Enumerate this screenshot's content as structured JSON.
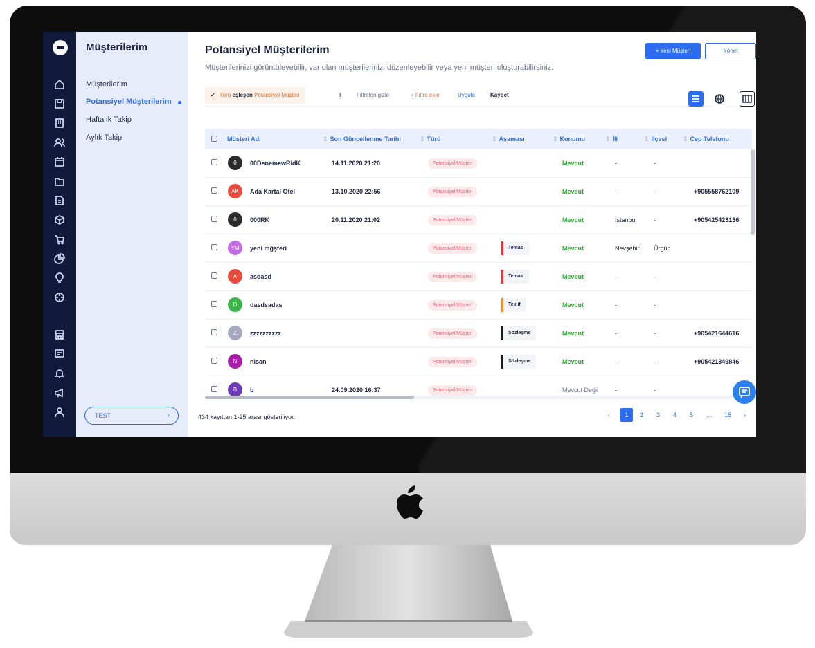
{
  "submenu": {
    "title": "Müşterilerim",
    "items": [
      {
        "label": "Müşterilerim"
      },
      {
        "label": "Potansiyel Müşterilerim"
      },
      {
        "label": "Haftalık Takip"
      },
      {
        "label": "Aylık Takip"
      }
    ],
    "account_label": "TEST",
    "account_chevron": "›"
  },
  "header": {
    "title": "Potansiyel Müşterilerim",
    "subtitle": "Müşterilerinizi görüntüleyebilir, var olan müşterilerinizi düzenleyebilir veya yeni müşteri oluşturabilirsiniz.",
    "new_button": "+ Yeni Müşteri",
    "manage_button": "Yönet"
  },
  "filters": {
    "chip_check": "✔",
    "chip_part1": "Türü",
    "chip_part2": "eşleşen",
    "chip_part3": "Potansiyel Müşteri",
    "plus": "+",
    "hide": "Filtreleri gizle",
    "add": "+ Filtre ekle",
    "apply": "Uygula",
    "save": "Kaydet"
  },
  "table": {
    "columns": [
      "Müşteri Adı",
      "Son Güncellenme Tarihi",
      "Türü",
      "Aşaması",
      "Konumu",
      "İli",
      "İlçesi",
      "Cep Telefonu"
    ],
    "rows": [
      {
        "initials": "0",
        "avatar_color": "#2b2b2b",
        "name": "00DenemewRidK",
        "date": "14.11.2020 21:20",
        "type": "Potansiyel Müşteri",
        "stage": "",
        "stage_color": "",
        "location": "Mevcut",
        "location_off": false,
        "city": "-",
        "district": "-",
        "phone": ""
      },
      {
        "initials": "AK",
        "avatar_color": "#ea4a3c",
        "name": "Ada Kartal Otel",
        "date": "13.10.2020 22:56",
        "type": "Potansiyel Müşteri",
        "stage": "",
        "stage_color": "",
        "location": "Mevcut",
        "location_off": false,
        "city": "-",
        "district": "-",
        "phone": "+905558762109"
      },
      {
        "initials": "0",
        "avatar_color": "#2b2b2b",
        "name": "000RK",
        "date": "20.11.2020 21:02",
        "type": "Potansiyel Müşteri",
        "stage": "",
        "stage_color": "",
        "location": "Mevcut",
        "location_off": false,
        "city": "İstanbul",
        "district": "-",
        "phone": "+905425423136"
      },
      {
        "initials": "YM",
        "avatar_color": "#c56ae8",
        "name": "yeni mğşteri",
        "date": "",
        "type": "Potansiyel Müşteri",
        "stage": "Temas",
        "stage_color": "#e43838",
        "location": "Mevcut",
        "location_off": false,
        "city": "Nevşehir",
        "district": "Ürgüp",
        "phone": ""
      },
      {
        "initials": "A",
        "avatar_color": "#ea4a3c",
        "name": "asdasd",
        "date": "",
        "type": "Potansiyel Müşteri",
        "stage": "Temas",
        "stage_color": "#e43838",
        "location": "Mevcut",
        "location_off": false,
        "city": "-",
        "district": "-",
        "phone": ""
      },
      {
        "initials": "D",
        "avatar_color": "#3cb54a",
        "name": "dasdsadas",
        "date": "",
        "type": "Potansiyel Müşteri",
        "stage": "Teklif",
        "stage_color": "#f08a2a",
        "location": "Mevcut",
        "location_off": false,
        "city": "-",
        "district": "-",
        "phone": ""
      },
      {
        "initials": "Z",
        "avatar_color": "#a6a8c2",
        "name": "zzzzzzzzzz",
        "date": "",
        "type": "Potansiyel Müşteri",
        "stage": "Sözleşme",
        "stage_color": "#1c1c1c",
        "location": "Mevcut",
        "location_off": false,
        "city": "-",
        "district": "-",
        "phone": "+905421644616"
      },
      {
        "initials": "N",
        "avatar_color": "#a41ea8",
        "name": "nisan",
        "date": "",
        "type": "Potansiyel Müşteri",
        "stage": "Sözleşme",
        "stage_color": "#1c1c1c",
        "location": "Mevcut",
        "location_off": false,
        "city": "-",
        "district": "-",
        "phone": "+905421349846"
      },
      {
        "initials": "B",
        "avatar_color": "#6a3ab8",
        "name": "b",
        "date": "24.09.2020 16:37",
        "type": "Potansiyel Müşteri",
        "stage": "",
        "stage_color": "",
        "location": "Mevcut Değil",
        "location_off": true,
        "city": "-",
        "district": "-",
        "phone": ""
      }
    ]
  },
  "footer": {
    "summary": "434 kayıttan 1-25 arası gösteriliyor.",
    "pages": [
      "‹",
      "1",
      "2",
      "3",
      "4",
      "5",
      "...",
      "18",
      "›"
    ],
    "active_page": "1"
  },
  "colors": {
    "accent": "#2b6cf0",
    "rail": "#101a3a",
    "submenu": "#e6ecfa",
    "positive": "#2faa34",
    "orange": "#f06a2a"
  },
  "icons": {
    "rail": [
      "home-icon",
      "save-icon",
      "building-icon",
      "users-icon",
      "calendar-icon",
      "folder-icon",
      "document-icon",
      "box-icon",
      "cart-icon",
      "pie-chart-icon",
      "bulb-icon",
      "target-icon",
      "store-icon",
      "chat-icon",
      "bell-icon",
      "megaphone-icon",
      "user-icon"
    ]
  }
}
